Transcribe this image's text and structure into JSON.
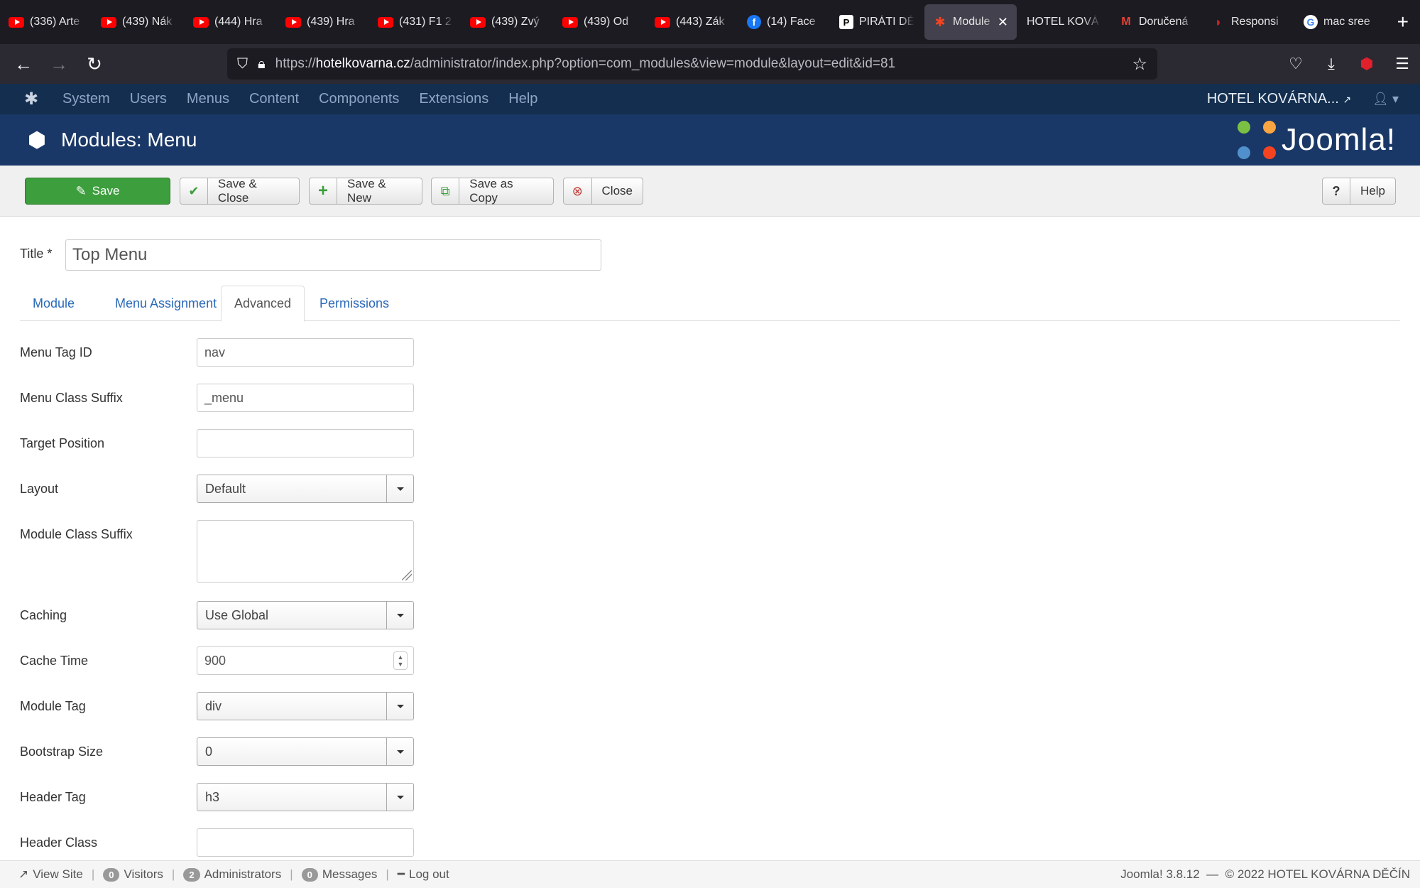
{
  "browser": {
    "tabs": [
      {
        "label": "(336) Arte",
        "favicon": "youtube-icon"
      },
      {
        "label": "(439) Nák",
        "favicon": "youtube-icon"
      },
      {
        "label": "(444) Hra",
        "favicon": "youtube-icon"
      },
      {
        "label": "(439) Hra",
        "favicon": "youtube-icon"
      },
      {
        "label": "(431) F1 2",
        "favicon": "youtube-icon"
      },
      {
        "label": "(439) Zvý",
        "favicon": "youtube-icon"
      },
      {
        "label": "(439) Od",
        "favicon": "youtube-icon"
      },
      {
        "label": "(443) Zák",
        "favicon": "youtube-icon"
      },
      {
        "label": "(14) Face",
        "favicon": "facebook-icon"
      },
      {
        "label": "PIRÁTI DĚ",
        "favicon": "pirati-icon"
      },
      {
        "label": "Module",
        "favicon": "joomla-icon",
        "active": true
      },
      {
        "label": "HOTEL KOVÁ",
        "favicon": "none"
      },
      {
        "label": "Doručená",
        "favicon": "gmail-icon"
      },
      {
        "label": "Responsi",
        "favicon": "responsive-icon"
      },
      {
        "label": "mac sree",
        "favicon": "google-icon"
      }
    ],
    "url_prefix": "https://",
    "url_host": "hotelkovarna.cz",
    "url_path": "/administrator/index.php?option=com_modules&view=module&layout=edit&id=81"
  },
  "admin_menu": {
    "items": [
      "System",
      "Users",
      "Menus",
      "Content",
      "Components",
      "Extensions",
      "Help"
    ],
    "site_link": "HOTEL KOVÁRNA..."
  },
  "header": {
    "title": "Modules: Menu",
    "brand": "Joomla!"
  },
  "toolbar": {
    "save": "Save",
    "save_close": "Save & Close",
    "save_new": "Save & New",
    "save_copy": "Save as Copy",
    "close": "Close",
    "help": "Help"
  },
  "form": {
    "title_label": "Title *",
    "title_value": "Top Menu",
    "tabs": [
      "Module",
      "Menu Assignment",
      "Advanced",
      "Permissions"
    ],
    "active_tab": "Advanced",
    "fields": {
      "menu_tag_id": {
        "label": "Menu Tag ID",
        "value": "nav"
      },
      "menu_class_suffix": {
        "label": "Menu Class Suffix",
        "value": "_menu"
      },
      "target_position": {
        "label": "Target Position",
        "value": ""
      },
      "layout": {
        "label": "Layout",
        "value": "Default"
      },
      "module_class_suffix": {
        "label": "Module Class Suffix",
        "value": ""
      },
      "caching": {
        "label": "Caching",
        "value": "Use Global"
      },
      "cache_time": {
        "label": "Cache Time",
        "value": "900"
      },
      "module_tag": {
        "label": "Module Tag",
        "value": "div"
      },
      "bootstrap_size": {
        "label": "Bootstrap Size",
        "value": "0"
      },
      "header_tag": {
        "label": "Header Tag",
        "value": "h3"
      },
      "header_class": {
        "label": "Header Class",
        "value": ""
      }
    }
  },
  "status": {
    "view_site": "View Site",
    "visitors_count": "0",
    "visitors_label": "Visitors",
    "admins_count": "2",
    "admins_label": "Administrators",
    "messages_count": "0",
    "messages_label": "Messages",
    "logout": "Log out",
    "version": "Joomla! 3.8.12",
    "dash": "—",
    "copyright": "© 2022 HOTEL KOVÁRNA DĚČÍN"
  }
}
